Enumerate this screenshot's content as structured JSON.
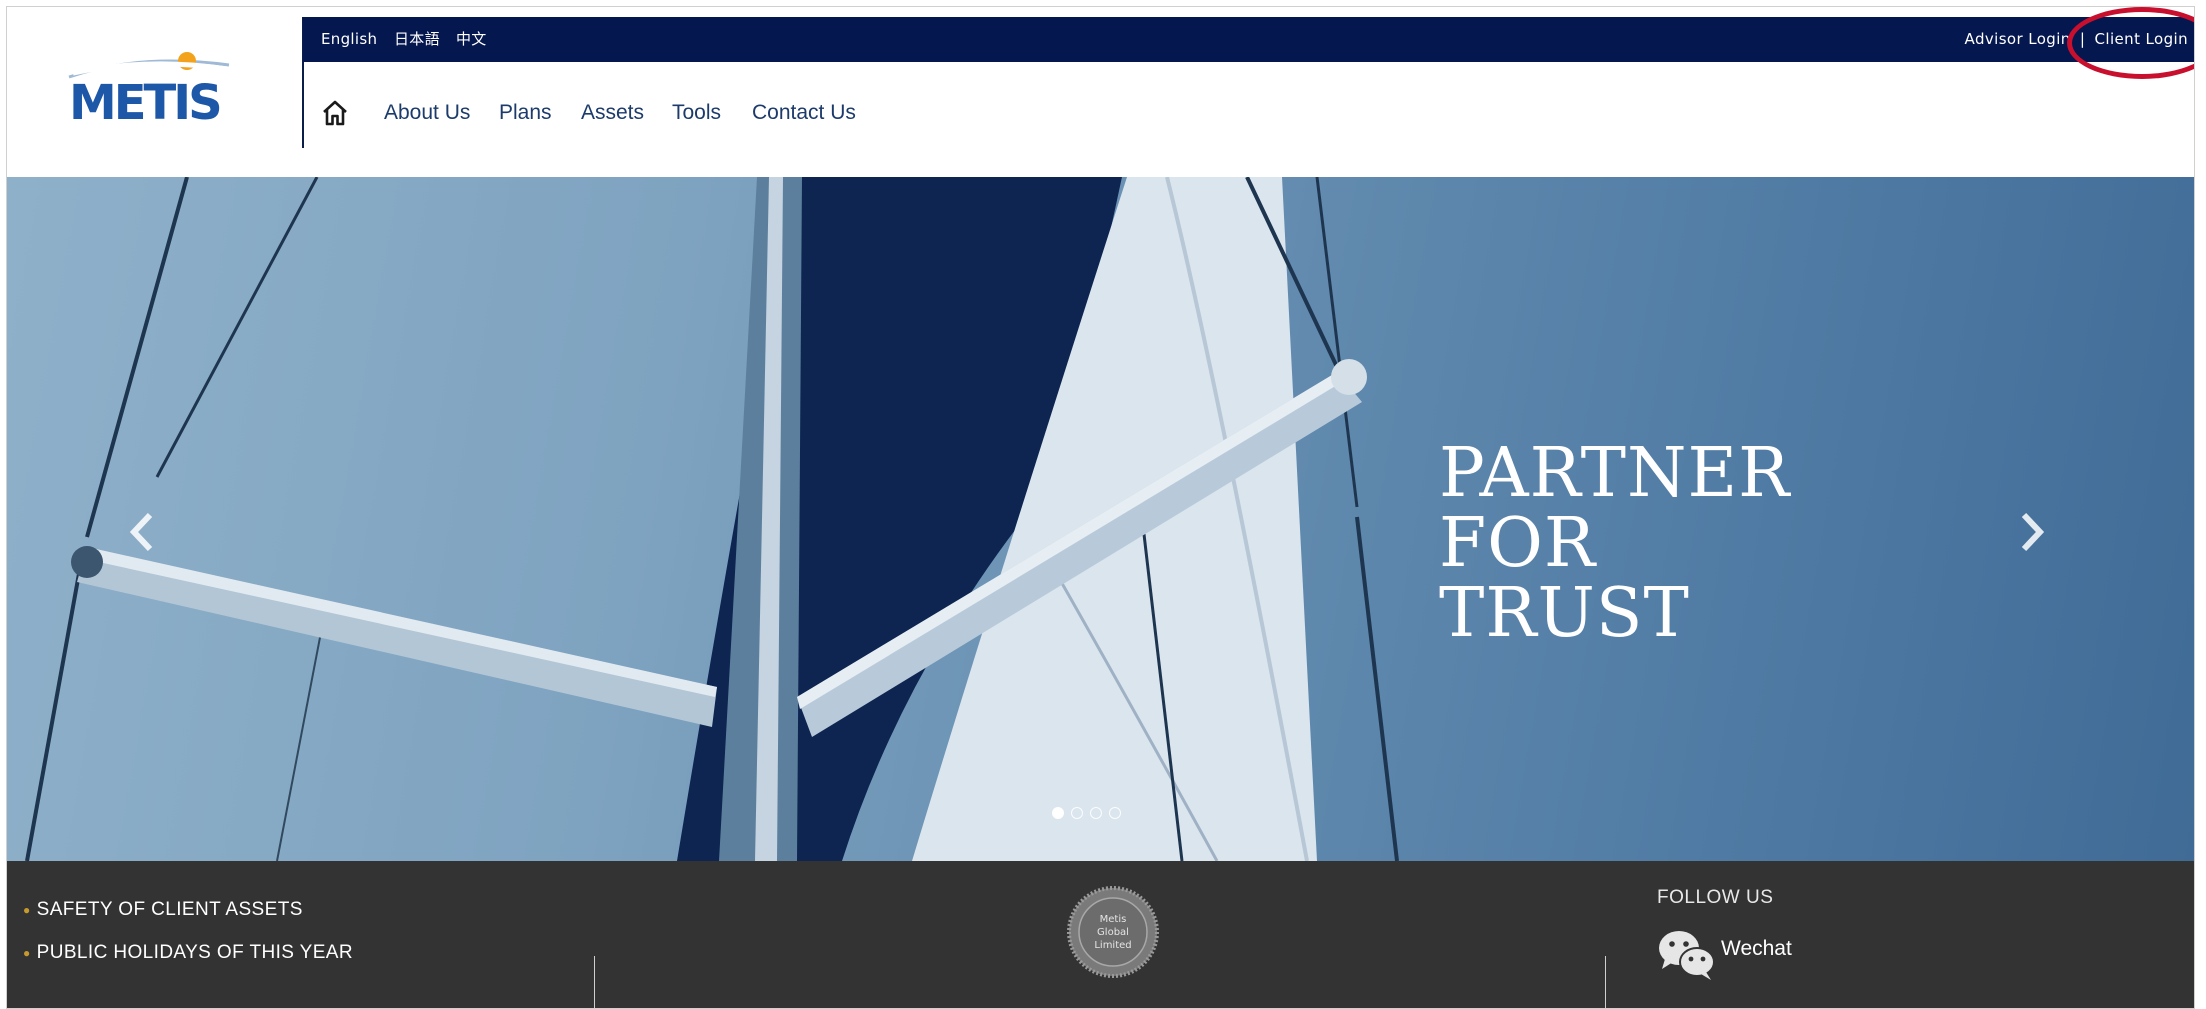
{
  "brand": {
    "logo_text": "METIS",
    "primary_color": "#04174f",
    "logo_blue": "#1d58a8",
    "logo_sun": "#f2a21b"
  },
  "topbar": {
    "languages": [
      "English",
      "日本語",
      "中文"
    ],
    "advisor_login": "Advisor Login",
    "separator": "|",
    "client_login": "Client Login"
  },
  "nav": {
    "home_icon": "home-icon",
    "items": [
      "About Us",
      "Plans",
      "Assets",
      "Tools",
      "Contact Us"
    ]
  },
  "hero": {
    "title_lines": [
      "PARTNER",
      "FOR",
      "TRUST"
    ],
    "prev_icon": "chevron-left-icon",
    "next_icon": "chevron-right-icon",
    "slide_count": 4,
    "active_slide": 1
  },
  "footer": {
    "links": [
      "SAFETY OF CLIENT ASSETS",
      "PUBLIC HOLIDAYS OF THIS YEAR"
    ],
    "bullet_color": "#c79a2e",
    "seal": {
      "lines": [
        "Metis",
        "Global",
        "Limited"
      ]
    },
    "follow_title": "FOLLOW US",
    "wechat_label": "Wechat",
    "wechat_icon": "wechat-icon"
  },
  "annotation": {
    "color": "#c8102e",
    "target": "client-login-link"
  }
}
